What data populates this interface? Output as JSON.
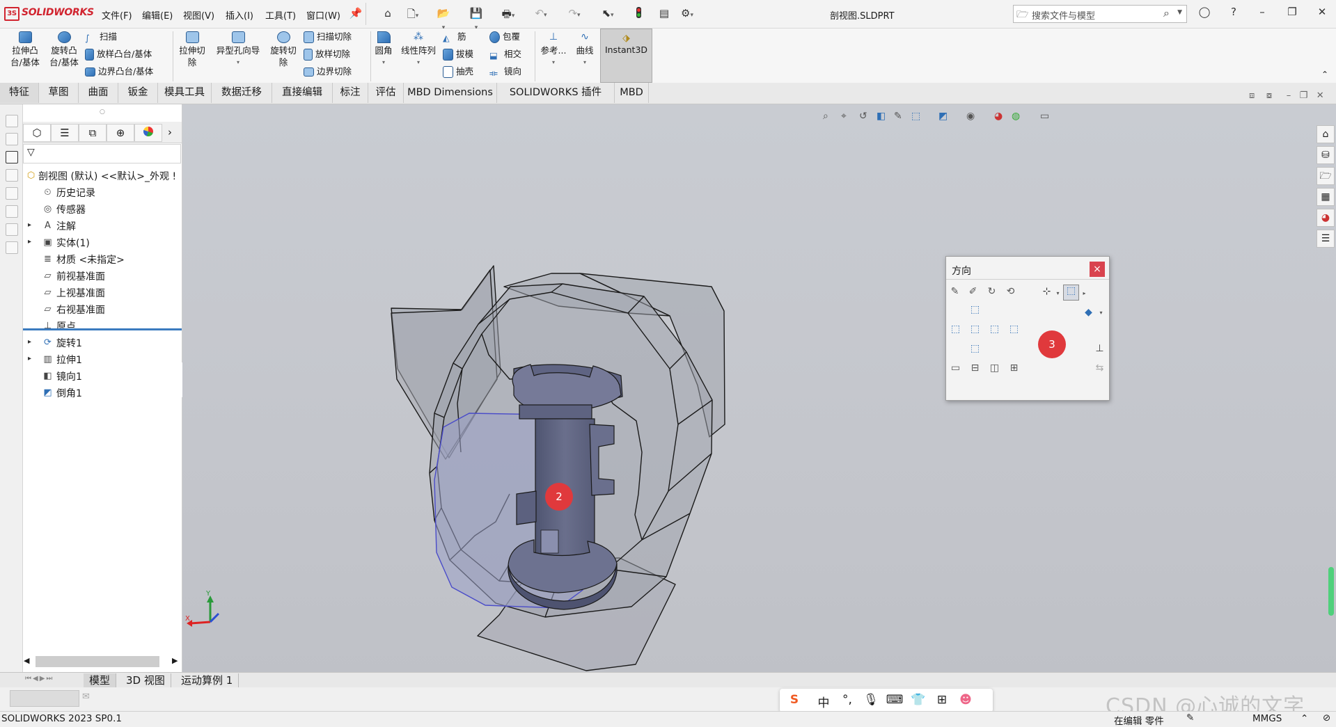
{
  "app": {
    "brand": "SOLIDWORKS",
    "doc_title": "剖视图.SLDPRT"
  },
  "menus": [
    "文件(F)",
    "编辑(E)",
    "视图(V)",
    "插入(I)",
    "工具(T)",
    "窗口(W)"
  ],
  "search": {
    "placeholder": "搜索文件与模型"
  },
  "commands": {
    "extrude_boss": "拉伸凸\n台/基体",
    "revolve_boss": "旋转凸\n台/基体",
    "sweep": "扫描",
    "loft": "放样凸台/基体",
    "boundary": "边界凸台/基体",
    "extrude_cut": "拉伸切\n除",
    "hole_wizard": "异型孔向导",
    "revolve_cut": "旋转切\n除",
    "swept_cut": "扫描切除",
    "lofted_cut": "放样切除",
    "boundary_cut": "边界切除",
    "fillet": "圆角",
    "linear_pattern": "线性阵列",
    "rib": "筋",
    "draft": "拔模",
    "shell": "抽壳",
    "wrap": "包覆",
    "intersect": "相交",
    "mirror": "镜向",
    "reference": "参考...",
    "curves": "曲线",
    "instant3d": "Instant3D"
  },
  "tabs": [
    {
      "label": "特征",
      "active": true
    },
    {
      "label": "草图"
    },
    {
      "label": "曲面"
    },
    {
      "label": "钣金"
    },
    {
      "label": "模具工具"
    },
    {
      "label": "数据迁移"
    },
    {
      "label": "直接编辑"
    },
    {
      "label": "标注"
    },
    {
      "label": "评估"
    },
    {
      "label": "MBD Dimensions"
    },
    {
      "label": "SOLIDWORKS 插件"
    },
    {
      "label": "MBD"
    }
  ],
  "feature_tree": {
    "root": "剖视图 (默认) <<默认>_外观 !",
    "items": [
      {
        "label": "历史记录",
        "icon": "history-icon",
        "expandable": false
      },
      {
        "label": "传感器",
        "icon": "sensor-icon",
        "expandable": false
      },
      {
        "label": "注解",
        "icon": "annotation-icon",
        "expandable": true
      },
      {
        "label": "实体(1)",
        "icon": "solid-bodies-icon",
        "expandable": true
      },
      {
        "label": "材质 <未指定>",
        "icon": "material-icon",
        "expandable": false
      },
      {
        "label": "前视基准面",
        "icon": "plane-icon",
        "expandable": false
      },
      {
        "label": "上视基准面",
        "icon": "plane-icon",
        "expandable": false
      },
      {
        "label": "右视基准面",
        "icon": "plane-icon",
        "expandable": false
      },
      {
        "label": "原点",
        "icon": "origin-icon",
        "expandable": false
      },
      {
        "label": "旋转1",
        "icon": "revolve-icon",
        "expandable": true
      },
      {
        "label": "拉伸1",
        "icon": "extrude-icon",
        "expandable": true
      },
      {
        "label": "镜向1",
        "icon": "mirror-icon",
        "expandable": false
      },
      {
        "label": "倒角1",
        "icon": "chamfer-icon",
        "expandable": false
      }
    ]
  },
  "orientation_dialog": {
    "title": "方向",
    "close": "×",
    "marker": "3"
  },
  "viewport": {
    "marker": "2",
    "triad": {
      "x": "X",
      "y": "Y"
    }
  },
  "model_tabs": [
    "模型",
    "3D 视图",
    "运动算例 1"
  ],
  "status": {
    "version": "SOLIDWORKS 2023 SP0.1",
    "mode": "在编辑 零件",
    "units": "MMGS"
  },
  "ime": {
    "lang": "中"
  },
  "watermark": "CSDN @心诚的文字",
  "colors": {
    "accent": "#2f6fb5",
    "marker": "#e0393c",
    "brand": "#d1242f"
  }
}
